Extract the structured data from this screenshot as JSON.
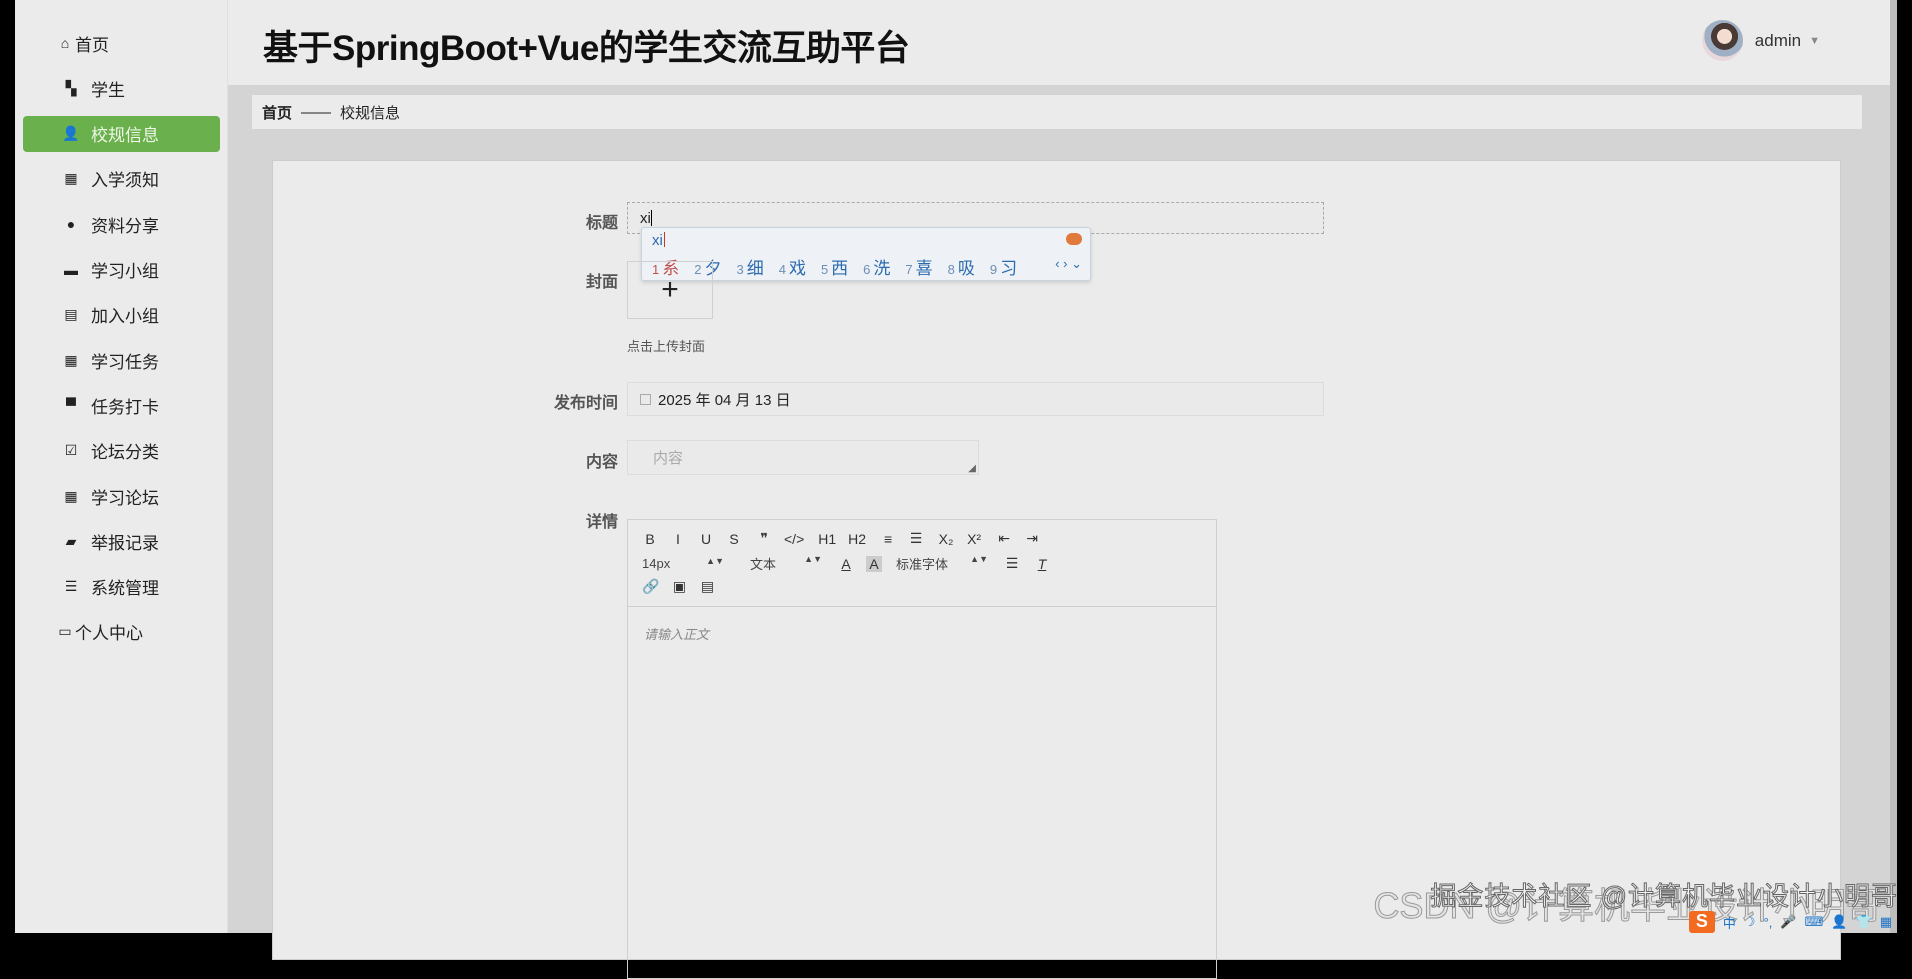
{
  "app_title": "基于SpringBoot+Vue的学生交流互助平台",
  "user": {
    "name": "admin"
  },
  "sidebar": {
    "items": [
      {
        "label": "首页",
        "icon": "home-icon"
      },
      {
        "label": "学生",
        "icon": "id-card-icon"
      },
      {
        "label": "校规信息",
        "icon": "user-icon",
        "active": true
      },
      {
        "label": "入学须知",
        "icon": "grid-icon"
      },
      {
        "label": "资料分享",
        "icon": "bulb-icon"
      },
      {
        "label": "学习小组",
        "icon": "briefcase-icon"
      },
      {
        "label": "加入小组",
        "icon": "clipboard-icon"
      },
      {
        "label": "学习任务",
        "icon": "grid-icon"
      },
      {
        "label": "任务打卡",
        "icon": "monitor-icon"
      },
      {
        "label": "论坛分类",
        "icon": "clipboard-check-icon"
      },
      {
        "label": "学习论坛",
        "icon": "grid-icon"
      },
      {
        "label": "举报记录",
        "icon": "wallet-icon"
      },
      {
        "label": "系统管理",
        "icon": "list-icon"
      },
      {
        "label": "个人中心",
        "icon": "card-icon"
      }
    ]
  },
  "breadcrumb": {
    "home": "首页",
    "sep": "——",
    "current": "校规信息"
  },
  "form": {
    "title_label": "标题",
    "title_value": "xi",
    "cover_label": "封面",
    "cover_plus": "+",
    "cover_hint": "点击上传封面",
    "date_label": "发布时间",
    "date_value": "2025 年 04 月 13 日",
    "content_label": "内容",
    "content_placeholder": "内容",
    "detail_label": "详情"
  },
  "ime": {
    "pinyin": "xi",
    "candidates": [
      {
        "n": "1",
        "c": "系"
      },
      {
        "n": "2",
        "c": "夕"
      },
      {
        "n": "3",
        "c": "细"
      },
      {
        "n": "4",
        "c": "戏"
      },
      {
        "n": "5",
        "c": "西"
      },
      {
        "n": "6",
        "c": "洗"
      },
      {
        "n": "7",
        "c": "喜"
      },
      {
        "n": "8",
        "c": "吸"
      },
      {
        "n": "9",
        "c": "习"
      }
    ],
    "nav": "‹ › ⌄"
  },
  "editor": {
    "row1": [
      "B",
      "I",
      "U",
      "S",
      "❞",
      "</>",
      "H1",
      "H2",
      "≡",
      "☰",
      "X₂",
      "X²",
      "⇤",
      "⇥"
    ],
    "size": "14px",
    "header": "文本",
    "font": "标准字体",
    "row3": [
      "🔗",
      "▣",
      "▤"
    ],
    "placeholder": "请输入正文"
  },
  "watermark": "掘金技术社区 @计算机毕业设计小明哥",
  "watermark2": "CSDN @计算机毕业设计小明哥",
  "tray": {
    "logo": "S",
    "mode": "中",
    "items": [
      "☽",
      "°,",
      "🎤",
      "⌨",
      "👤",
      "👕",
      "▦"
    ]
  }
}
